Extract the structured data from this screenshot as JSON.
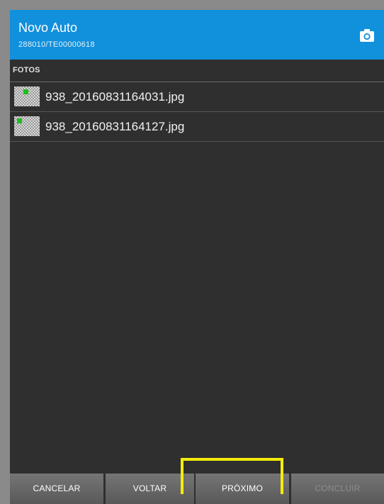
{
  "header": {
    "title": "Novo Auto",
    "subtitle": "288010/TE00000618",
    "camera_icon": "camera-icon",
    "background_color": "#1190dc"
  },
  "section": {
    "title": "FOTOS"
  },
  "photos": [
    {
      "filename": "938_20160831164031.jpg",
      "icon": "image-thumbnail-icon"
    },
    {
      "filename": "938_20160831164127.jpg",
      "icon": "image-thumbnail-icon"
    }
  ],
  "buttons": {
    "cancel": "CANCELAR",
    "back": "VOLTAR",
    "next": "PRÓXIMO",
    "finish": "CONCLUIR"
  },
  "highlight_color": "#f5ec0a"
}
